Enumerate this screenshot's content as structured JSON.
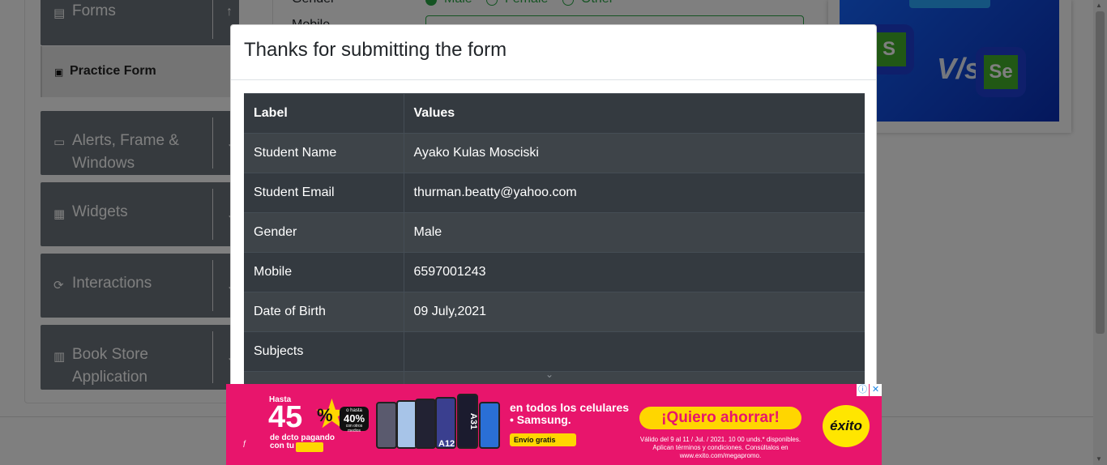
{
  "background": {
    "sidebar": {
      "groups": [
        {
          "label": "Forms",
          "icon": "document-icon",
          "chevron": "↑"
        },
        {
          "label": "Alerts, Frame & Windows",
          "line1": "Alerts, Frame &",
          "line2": "Windows",
          "icon": "window-icon",
          "chevron": "⌄"
        },
        {
          "label": "Widgets",
          "icon": "widgets-icon",
          "chevron": "⌄"
        },
        {
          "label": "Interactions",
          "icon": "interactions-icon",
          "chevron": "⌄"
        },
        {
          "label": "Book Store Application",
          "line1": "Book Store",
          "line2": "Application",
          "icon": "books-icon",
          "chevron": "⌄"
        }
      ],
      "active_item": "Practice Form"
    },
    "form": {
      "gender_label": "Gender",
      "gender_options": [
        "Male",
        "Female",
        "Other"
      ],
      "gender_selected": "Male",
      "mobile_label": "Mobile"
    },
    "right_ad": {
      "left_letter": "S",
      "vs_text": "V/s",
      "right_letters": "Se"
    }
  },
  "modal": {
    "title": "Thanks for submitting the form",
    "table": {
      "headers": [
        "Label",
        "Values"
      ],
      "rows": [
        [
          "Student Name",
          "Ayako Kulas Mosciski"
        ],
        [
          "Student Email",
          "thurman.beatty@yahoo.com"
        ],
        [
          "Gender",
          "Male"
        ],
        [
          "Mobile",
          "6597001243"
        ],
        [
          "Date of Birth",
          "09 July,2021"
        ],
        [
          "Subjects",
          ""
        ]
      ]
    },
    "scroll_hint_icon": "chevron-down-icon"
  },
  "bottom_ad": {
    "controls": [
      "ⓘ",
      "✕"
    ],
    "hasta": "Hasta",
    "big_number": "45",
    "percent": "%",
    "badge_top": "o hasta",
    "badge_value": "40%",
    "badge_bottom": "con otros medios",
    "discount_text": "de dcto pagando con tu",
    "phones": [
      "A12",
      "A31"
    ],
    "headline": "en todos los celulares • Samsung.",
    "envio": "Envío gratis",
    "cta": "¡Quiero ahorrar!",
    "fine_print": "Válido del 9 al 11 / Jul. / 2021. 10 00 unds.* disponibles. Aplican términos y condiciones. Consúltalos en www.exito.com/megapromo.",
    "brand": "éxito",
    "colors": {
      "background": "#e8156c",
      "accent": "#ffd600"
    }
  }
}
